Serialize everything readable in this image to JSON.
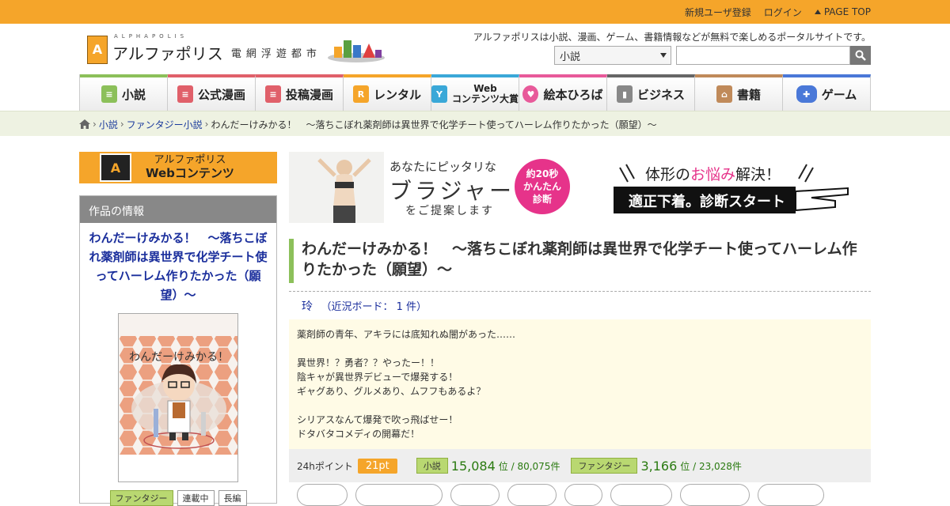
{
  "topbar": {
    "register": "新規ユーザ登録",
    "login": "ログイン",
    "pagetop": "PAGE TOP"
  },
  "header": {
    "logo_sub": "ALPHAPOLIS",
    "logo_main": "アルファポリス",
    "logo_city": "電網浮遊都市",
    "tagline": "アルファポリスは小説、漫画、ゲーム、書籍情報などが無料で楽しめるポータルサイトです。",
    "search_select": "小説",
    "search_value": ""
  },
  "nav": {
    "items": [
      {
        "label": "小説",
        "color": "#8cc05a"
      },
      {
        "label": "公式漫画",
        "color": "#e0606a"
      },
      {
        "label": "投稿漫画",
        "color": "#e0606a"
      },
      {
        "label": "レンタル",
        "color": "#f5a52a"
      },
      {
        "label1": "Web",
        "label2": "コンテンツ大賞",
        "color": "#3aa8d8"
      },
      {
        "label": "絵本ひろば",
        "color": "#e85a9a"
      },
      {
        "label": "ビジネス",
        "color": "#666666"
      },
      {
        "label": "書籍",
        "color": "#c08a5a"
      },
      {
        "label": "ゲーム",
        "color": "#4a78d8"
      }
    ]
  },
  "breadcrumb": {
    "novel": "小説",
    "genre": "ファンタジー小説",
    "current": "わんだーけみかる！　〜落ちこぼれ薬剤師は異世界で化学チート使ってハーレム作りたかった（願望）〜"
  },
  "sidebar": {
    "banner_line1": "アルファポリス",
    "banner_line2": "Webコンテンツ",
    "head": "作品の情報",
    "title": "わんだーけみかる！　〜落ちこぼれ薬剤師は異世界で化学チート使ってハーレム作りたかった（願望）〜",
    "cover_text": "わんだーけみかる！",
    "tags": [
      "ファンタジー",
      "連載中",
      "長編"
    ]
  },
  "ad": {
    "line1": "あなたにピッタリな",
    "line2": "ブラジャー",
    "line3": "をご提案します",
    "badge1": "約20秒",
    "badge2": "かんたん",
    "badge3": "診断",
    "right1a": "体形の",
    "right1b": "お悩み",
    "right1c": "解決！",
    "cta": "適正下着。診断スタート"
  },
  "work": {
    "title": "わんだーけみかる！　〜落ちこぼれ薬剤師は異世界で化学チート使ってハーレム作りたかった（願望）〜",
    "author": "玲",
    "board": "（近況ボード： 1 件）",
    "synopsis": "薬剤師の青年、アキラには底知れぬ闇があった……\n\n異世界！？勇者？？やったー！！\n陰キャが異世界デビューで爆発する！\nギャグあり、グルメあり、ムフフもあるよ？\n\nシリアスなんて爆発で吹っ飛ばせー！\nドタバタコメディの開幕だ！"
  },
  "stats": {
    "points_label": "24hポイント",
    "points": "21pt",
    "cat1": "小説",
    "rank1": "15,084",
    "den1": "位 / 80,075件",
    "cat2": "ファンタジー",
    "rank2": "3,166",
    "den2": "位 / 23,028件"
  }
}
